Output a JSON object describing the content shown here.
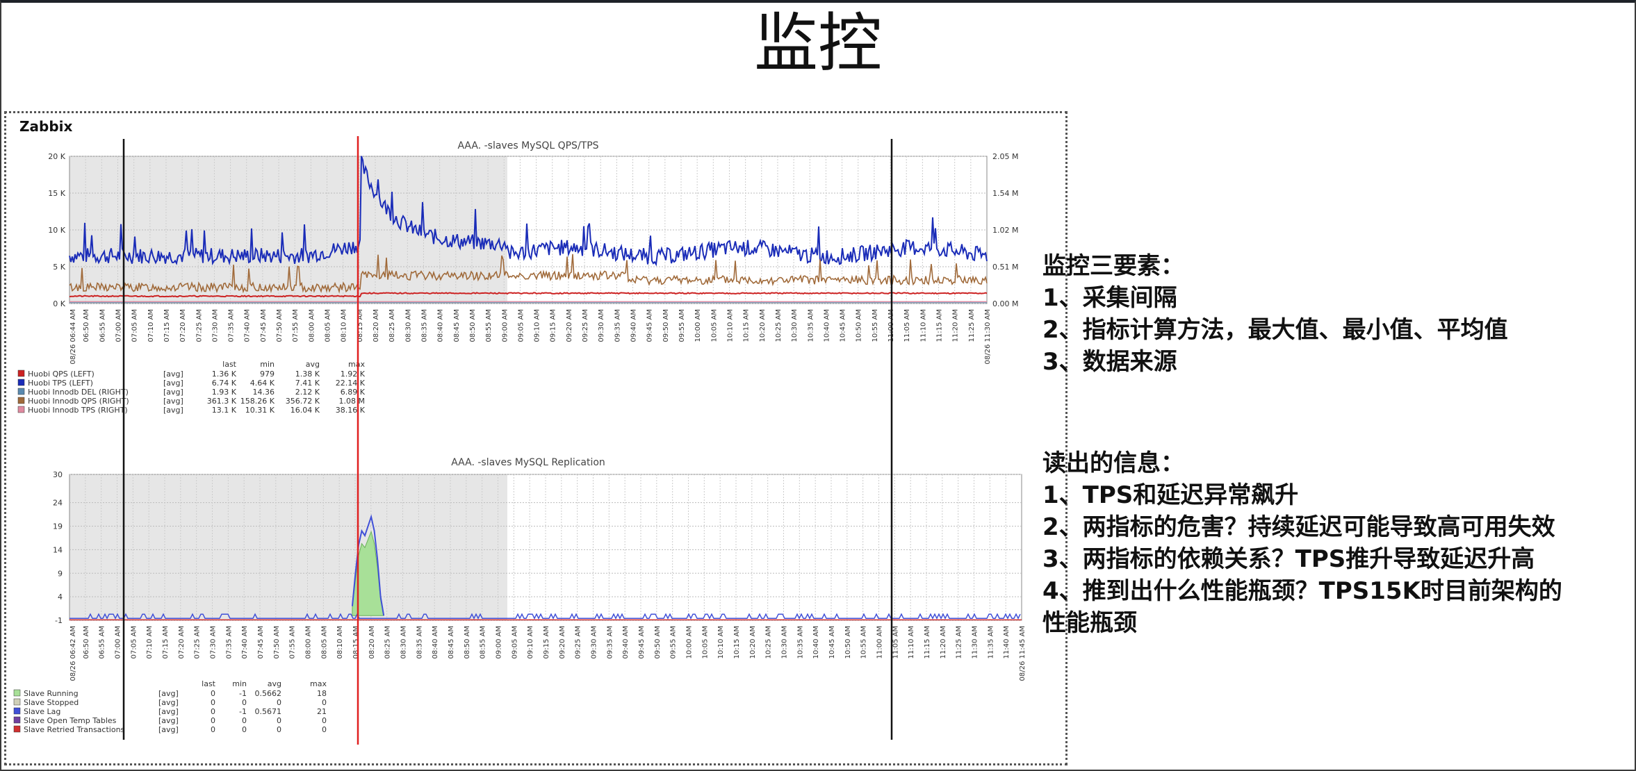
{
  "slide": {
    "title": "监控",
    "zabbix_label": "Zabbix"
  },
  "notes": {
    "section1_title": "监控三要素：",
    "section1_items": [
      "1、采集间隔",
      "2、指标计算方法，最大值、最小值、平均值",
      "3、数据来源"
    ],
    "section2_title": "读出的信息：",
    "section2_items": [
      "1、TPS和延迟异常飙升",
      "2、两指标的危害？持续延迟可能导致高可用失效",
      "3、两指标的依赖关系？TPS推升导致延迟升高",
      "4、推到出什么性能瓶颈？TPS15K时目前架构的",
      "性能瓶颈"
    ]
  },
  "chart_data": [
    {
      "type": "line",
      "title": "AAA.          -slaves           MySQL QPS/TPS",
      "y_left_ticks": [
        "0 K",
        "5 K",
        "10 K",
        "15 K",
        "20 K"
      ],
      "y_right_ticks": [
        "0.00 M",
        "0.51 M",
        "1.02 M",
        "1.54 M",
        "2.05 M"
      ],
      "ylim_left": [
        0,
        20000
      ],
      "x_start_label": "08/26 06:44 AM",
      "x_end_label": "08/26 11:30 AM",
      "x_ticks": [
        "06:50 AM",
        "06:55 AM",
        "07:00 AM",
        "07:05 AM",
        "07:10 AM",
        "07:15 AM",
        "07:20 AM",
        "07:25 AM",
        "07:30 AM",
        "07:35 AM",
        "07:40 AM",
        "07:45 AM",
        "07:50 AM",
        "07:55 AM",
        "08:00 AM",
        "08:05 AM",
        "08:10 AM",
        "08:15 AM",
        "08:20 AM",
        "08:25 AM",
        "08:30 AM",
        "08:35 AM",
        "08:40 AM",
        "08:45 AM",
        "08:50 AM",
        "08:55 AM",
        "09:00 AM",
        "09:05 AM",
        "09:10 AM",
        "09:15 AM",
        "09:20 AM",
        "09:25 AM",
        "09:30 AM",
        "09:35 AM",
        "09:40 AM",
        "09:45 AM",
        "09:50 AM",
        "09:55 AM",
        "10:00 AM",
        "10:05 AM",
        "10:10 AM",
        "10:15 AM",
        "10:20 AM",
        "10:25 AM",
        "10:30 AM",
        "10:35 AM",
        "10:40 AM",
        "10:45 AM",
        "10:50 AM",
        "10:55 AM",
        "11:00 AM",
        "11:05 AM",
        "11:10 AM",
        "11:15 AM",
        "11:20 AM",
        "11:25 AM"
      ],
      "legend_headers": [
        "last",
        "min",
        "avg",
        "max"
      ],
      "legend": [
        {
          "name": "Huobi QPS (LEFT)",
          "agg": "[avg]",
          "last": "1.36 K",
          "min": "979",
          "avg": "1.38 K",
          "max": "1.92 K",
          "color": "#cc2222"
        },
        {
          "name": "Huobi TPS (LEFT)",
          "agg": "[avg]",
          "last": "6.74 K",
          "min": "4.64 K",
          "avg": "7.41 K",
          "max": "22.14 K",
          "color": "#1a2cb8"
        },
        {
          "name": "Huobi Innodb DEL (RIGHT)",
          "agg": "[avg]",
          "last": "1.93 K",
          "min": "14.36",
          "avg": "2.12 K",
          "max": "6.89 K",
          "color": "#5a8ab0"
        },
        {
          "name": "Huobi Innodb QPS (RIGHT)",
          "agg": "[avg]",
          "last": "361.3 K",
          "min": "158.26 K",
          "avg": "356.72 K",
          "max": "1.08 M",
          "color": "#a06a3a"
        },
        {
          "name": "Huobi Innodb TPS (RIGHT)",
          "agg": "[avg]",
          "last": "13.1 K",
          "min": "10.31 K",
          "avg": "16.04 K",
          "max": "38.16 K",
          "color": "#e08aa0"
        }
      ],
      "series_profile": {
        "tps_left": {
          "baseline": 6500,
          "spike_at": "08:13 AM",
          "spike_peak": 19500,
          "decay_to": 8000,
          "end": 7000
        },
        "innodb_qps_right_as_left": {
          "baseline": 2200,
          "mid": 3800,
          "end": 3200
        },
        "qps_left": {
          "baseline": 1000,
          "end": 1400
        }
      }
    },
    {
      "type": "area",
      "title": "AAA.          -slaves           MySQL Replication",
      "y_ticks": [
        "-1",
        "4",
        "9",
        "14",
        "19",
        "24",
        "30"
      ],
      "ylim": [
        -1,
        30
      ],
      "x_start_label": "08/26 06:42 AM",
      "x_end_label": "08/26 11:45 AM",
      "x_ticks": [
        "06:50 AM",
        "06:55 AM",
        "07:00 AM",
        "07:05 AM",
        "07:10 AM",
        "07:15 AM",
        "07:20 AM",
        "07:25 AM",
        "07:30 AM",
        "07:35 AM",
        "07:40 AM",
        "07:45 AM",
        "07:50 AM",
        "07:55 AM",
        "08:00 AM",
        "08:05 AM",
        "08:10 AM",
        "08:15 AM",
        "08:20 AM",
        "08:25 AM",
        "08:30 AM",
        "08:35 AM",
        "08:40 AM",
        "08:45 AM",
        "08:50 AM",
        "08:55 AM",
        "09:00 AM",
        "09:05 AM",
        "09:10 AM",
        "09:15 AM",
        "09:20 AM",
        "09:25 AM",
        "09:30 AM",
        "09:35 AM",
        "09:40 AM",
        "09:45 AM",
        "09:50 AM",
        "09:55 AM",
        "10:00 AM",
        "10:05 AM",
        "10:10 AM",
        "10:15 AM",
        "10:20 AM",
        "10:25 AM",
        "10:30 AM",
        "10:35 AM",
        "10:40 AM",
        "10:45 AM",
        "10:50 AM",
        "10:55 AM",
        "11:00 AM",
        "11:05 AM",
        "11:10 AM",
        "11:15 AM",
        "11:20 AM",
        "11:25 AM",
        "11:30 AM",
        "11:35 AM",
        "11:40 AM"
      ],
      "legend_headers": [
        "last",
        "min",
        "avg",
        "max"
      ],
      "legend": [
        {
          "name": "Slave Running",
          "agg": "[avg]",
          "last": "0",
          "min": "-1",
          "avg": "0.5662",
          "max": "18",
          "color": "#a8e098"
        },
        {
          "name": "Slave Stopped",
          "agg": "[avg]",
          "last": "0",
          "min": "0",
          "avg": "0",
          "max": "0",
          "color": "#d0d0b8"
        },
        {
          "name": "Slave Lag",
          "agg": "[avg]",
          "last": "0",
          "min": "-1",
          "avg": "0.5671",
          "max": "21",
          "color": "#4050d8"
        },
        {
          "name": "Slave Open Temp Tables",
          "agg": "[avg]",
          "last": "0",
          "min": "0",
          "avg": "0",
          "max": "0",
          "color": "#7040a0"
        },
        {
          "name": "Slave Retried Transactions",
          "agg": "[avg]",
          "last": "0",
          "min": "0",
          "avg": "0",
          "max": "0",
          "color": "#d03030"
        }
      ],
      "lag_spike": [
        {
          "t": "08:12 AM",
          "v": 2
        },
        {
          "t": "08:13 AM",
          "v": 9
        },
        {
          "t": "08:14 AM",
          "v": 15
        },
        {
          "t": "08:15 AM",
          "v": 18
        },
        {
          "t": "08:16 AM",
          "v": 17
        },
        {
          "t": "08:17 AM",
          "v": 19
        },
        {
          "t": "08:18 AM",
          "v": 21
        },
        {
          "t": "08:19 AM",
          "v": 18
        },
        {
          "t": "08:20 AM",
          "v": 12
        },
        {
          "t": "08:21 AM",
          "v": 4
        },
        {
          "t": "08:22 AM",
          "v": 0
        }
      ]
    }
  ]
}
